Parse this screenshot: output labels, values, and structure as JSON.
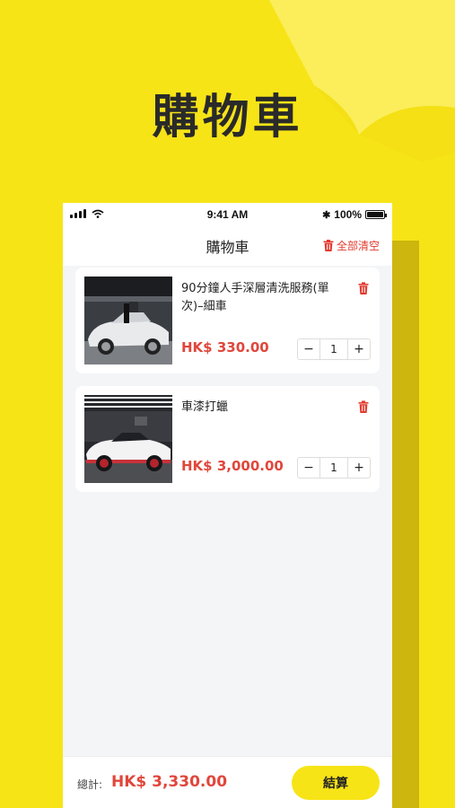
{
  "hero": {
    "title": "購物車"
  },
  "status_bar": {
    "time": "9:41 AM",
    "battery": "100%"
  },
  "nav": {
    "title": "購物車",
    "clear_all": "全部清空"
  },
  "cart_items": [
    {
      "title": "90分鐘人手深層清洗服務(單次)–細車",
      "price": "HK$ 330.00",
      "quantity": "1"
    },
    {
      "title": "車漆打蠟",
      "price": "HK$ 3,000.00",
      "quantity": "1"
    }
  ],
  "stepper": {
    "minus": "−",
    "plus": "+"
  },
  "footer": {
    "total_label": "總計:",
    "total_value": "HK$ 3,330.00",
    "checkout_label": "結算"
  },
  "colors": {
    "brand_yellow": "#f7e417",
    "price_red": "#e0473b",
    "delete_red": "#e23a2e"
  }
}
